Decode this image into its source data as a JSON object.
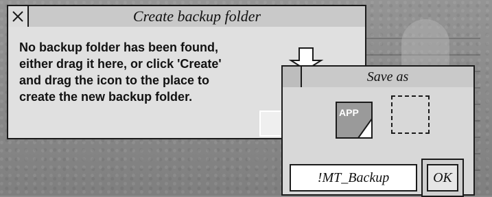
{
  "main_window": {
    "title": "Create backup folder",
    "message_lines": [
      "No backup folder has been found,",
      "either drag it here, or click 'Create'",
      "and drag the icon to the place to",
      "create the new backup folder."
    ]
  },
  "save_as": {
    "title": "Save as",
    "icon_label": "APP",
    "filename": "!MT_Backup",
    "ok_label": "OK"
  },
  "icons": {
    "close": "close-icon",
    "app": "app-file-icon",
    "drag_arrow": "drag-arrow-icon"
  }
}
